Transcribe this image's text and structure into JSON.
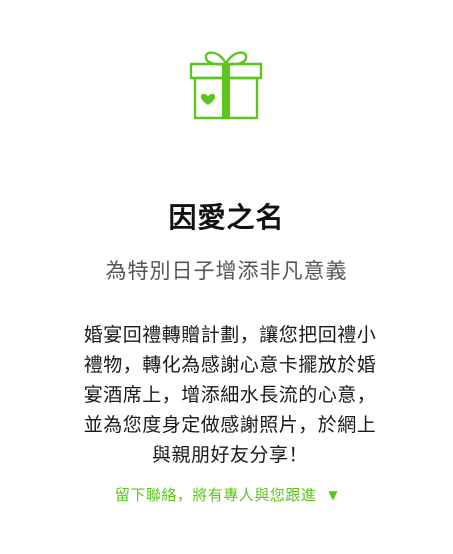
{
  "icon": "gift-heart-icon",
  "accent_color": "#5cc51e",
  "title": "因愛之名",
  "subtitle": "為特別日子增添非凡意義",
  "body": "婚宴回禮轉贈計劃，讓您把回禮小禮物，轉化為感謝心意卡擺放於婚宴酒席上，增添細水長流的心意，並為您度身定做感謝照片，於網上與親朋好友分享！",
  "cta": {
    "label": "留下聯絡，將有專人與您跟進",
    "arrow": "▼",
    "arrow_icon": "triangle-down-icon"
  }
}
